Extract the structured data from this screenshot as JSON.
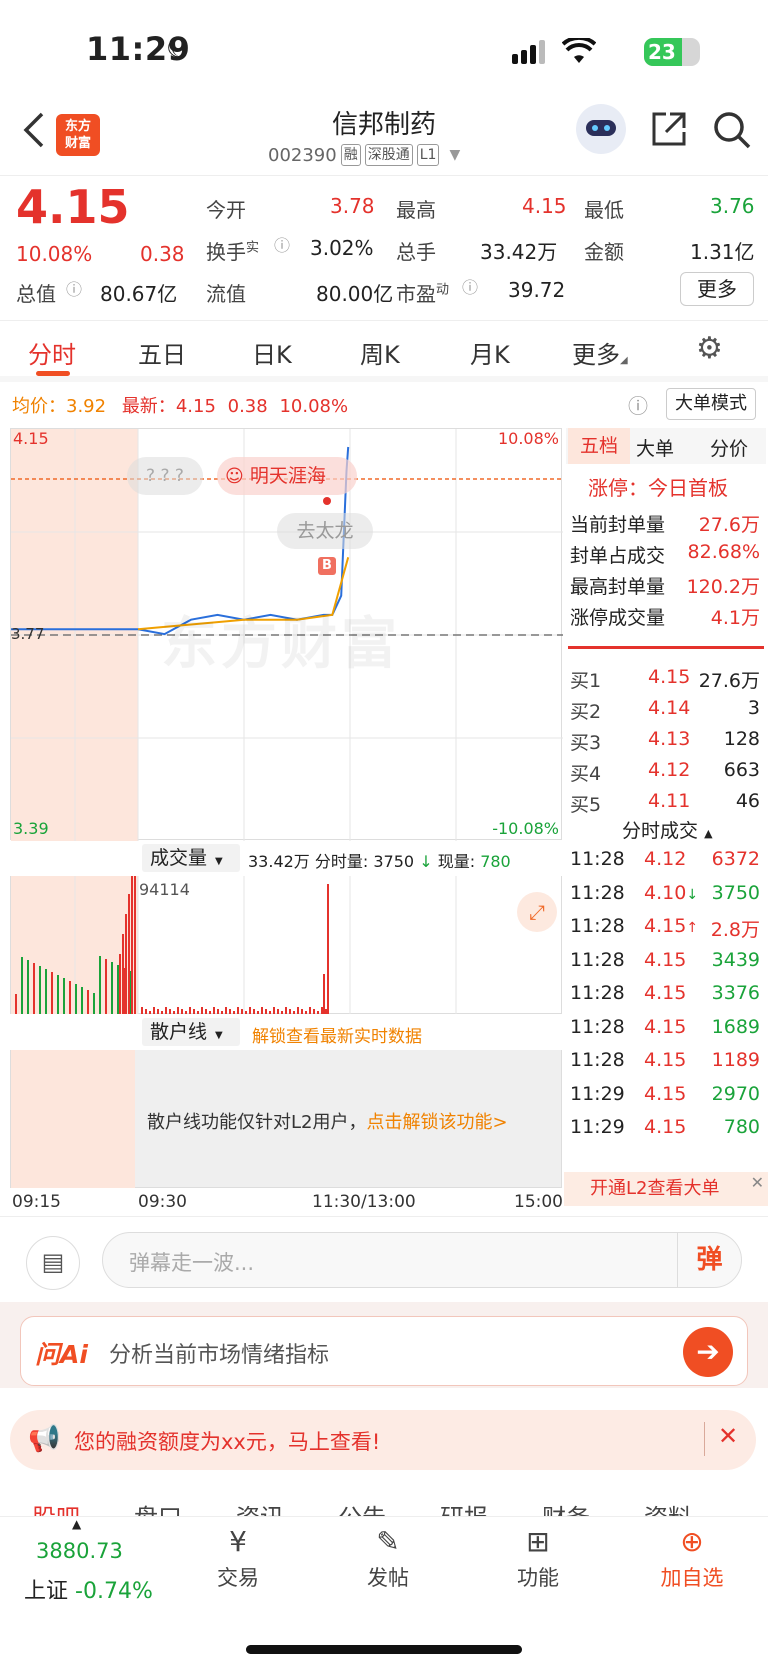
{
  "status": {
    "time": "11:29",
    "battery": "23"
  },
  "header": {
    "logo_line1": "东方",
    "logo_line2": "财富",
    "name": "信邦制药",
    "code": "002390",
    "tags": [
      "融",
      "深股通",
      "L1"
    ]
  },
  "quote": {
    "price": "4.15",
    "change_pct": "10.08%",
    "change": "0.38",
    "open_label": "今开",
    "open": "3.78",
    "high_label": "最高",
    "high": "4.15",
    "low_label": "最低",
    "low": "3.76",
    "turnover_label": "换手",
    "turnover_sup": "实",
    "turnover": "3.02%",
    "volume_label": "总手",
    "volume": "33.42万",
    "amount_label": "金额",
    "amount": "1.31亿",
    "mcap_label": "总值",
    "mcap": "80.67亿",
    "float_label": "流值",
    "float": "80.00亿",
    "pe_label": "市盈",
    "pe_sup": "动",
    "pe": "39.72",
    "more": "更多"
  },
  "tabs": [
    "分时",
    "五日",
    "日K",
    "周K",
    "月K",
    "更多"
  ],
  "infoline": {
    "avg_label": "均价：",
    "avg": "3.92",
    "latest_label": "最新：",
    "latest": "4.15",
    "latest_chg": "0.38",
    "latest_pct": "10.08%",
    "big_order_mode": "大单模式"
  },
  "chart": {
    "y_top": "4.15",
    "y_bottom": "3.39",
    "y_mid": "3.77",
    "pct_top": "10.08%",
    "pct_bottom": "-10.08%",
    "bubble1": "? ? ?",
    "bubble2": "明天涯海",
    "bubble3": "去太龙",
    "marker": "B",
    "watermark": "东方财富"
  },
  "chart_data": {
    "type": "line",
    "title": "",
    "ylim": [
      3.39,
      4.15
    ],
    "series": [
      {
        "name": "",
        "color": "#2a6fdb",
        "x": [
          "09:15",
          "09:30",
          "09:45",
          "10:00",
          "10:15",
          "10:30",
          "10:45",
          "11:00",
          "11:15",
          "11:20",
          "11:25",
          "11:28",
          "11:29"
        ],
        "values": [
          3.77,
          3.77,
          3.76,
          3.79,
          3.8,
          3.79,
          3.8,
          3.79,
          3.8,
          3.8,
          3.84,
          4.1,
          4.15
        ]
      },
      {
        "name": "",
        "color": "#f0a000",
        "x": [
          "09:30",
          "10:00",
          "10:30",
          "11:00",
          "11:20",
          "11:29"
        ],
        "values": [
          3.77,
          3.78,
          3.79,
          3.79,
          3.8,
          3.92
        ]
      }
    ],
    "x_ticks": [
      "09:15",
      "09:30",
      "11:30/13:00",
      "15:00"
    ]
  },
  "volume": {
    "label": "成交量",
    "summary": "33.42万 分时量: 3750",
    "now_label": "现量:",
    "now": "780",
    "peak": "94114"
  },
  "retail": {
    "label": "散户线",
    "unlock_hint": "解锁查看最新实时数据",
    "msg": "散户线功能仅针对L2用户，",
    "msg_link": "点击解锁该功能>"
  },
  "xaxis": [
    "09:15",
    "09:30",
    "11:30/13:00",
    "15:00"
  ],
  "right_panel": {
    "tabs": [
      "五档",
      "大单",
      "分价"
    ],
    "limit_label": "涨停：",
    "limit_value": "今日首板",
    "stats": [
      {
        "label": "当前封单量",
        "value": "27.6万"
      },
      {
        "label": "封单占成交",
        "value": "82.68%"
      },
      {
        "label": "最高封单量",
        "value": "120.2万"
      },
      {
        "label": "涨停成交量",
        "value": "4.1万"
      }
    ],
    "bids": [
      {
        "label": "买1",
        "price": "4.15",
        "vol": "27.6万"
      },
      {
        "label": "买2",
        "price": "4.14",
        "vol": "3"
      },
      {
        "label": "买3",
        "price": "4.13",
        "vol": "128"
      },
      {
        "label": "买4",
        "price": "4.12",
        "vol": "663"
      },
      {
        "label": "买5",
        "price": "4.11",
        "vol": "46"
      }
    ],
    "ticks_title": "分时成交",
    "ticks": [
      {
        "t": "11:28",
        "p": "4.12",
        "v": "6372",
        "pc": "red",
        "vc": "red",
        "arrow": ""
      },
      {
        "t": "11:28",
        "p": "4.10",
        "v": "3750",
        "pc": "red",
        "vc": "green",
        "arrow": "↓"
      },
      {
        "t": "11:28",
        "p": "4.15",
        "v": "2.8万",
        "pc": "red",
        "vc": "red",
        "arrow": "↑"
      },
      {
        "t": "11:28",
        "p": "4.15",
        "v": "3439",
        "pc": "red",
        "vc": "green",
        "arrow": ""
      },
      {
        "t": "11:28",
        "p": "4.15",
        "v": "3376",
        "pc": "red",
        "vc": "green",
        "arrow": ""
      },
      {
        "t": "11:28",
        "p": "4.15",
        "v": "1689",
        "pc": "red",
        "vc": "green",
        "arrow": ""
      },
      {
        "t": "11:28",
        "p": "4.15",
        "v": "1189",
        "pc": "red",
        "vc": "red",
        "arrow": ""
      },
      {
        "t": "11:29",
        "p": "4.15",
        "v": "2970",
        "pc": "red",
        "vc": "green",
        "arrow": ""
      },
      {
        "t": "11:29",
        "p": "4.15",
        "v": "780",
        "pc": "red",
        "vc": "green",
        "arrow": ""
      }
    ],
    "l2_banner": "开通L2查看大单"
  },
  "danmu": {
    "placeholder": "弹幕走一波...",
    "btn": "弹"
  },
  "ai": {
    "logo": "问Ai",
    "text": "分析当前市场情绪指标"
  },
  "notice": {
    "text": "您的融资额度为xx元，马上查看!"
  },
  "bottom_tabs": [
    "股吧",
    "盘口",
    "资讯",
    "公告",
    "研报",
    "财务",
    "资料"
  ],
  "bottom_nav": {
    "index_value": "3880.73",
    "index_name": "上证",
    "index_chg": "-0.74%",
    "trade": "交易",
    "post": "发帖",
    "func": "功能",
    "add": "加自选"
  },
  "colors": {
    "up": "#e4322c",
    "down": "#1aa33a",
    "accent": "#f04e23",
    "price_line": "#2a6fdb",
    "avg_line": "#f0a000"
  }
}
